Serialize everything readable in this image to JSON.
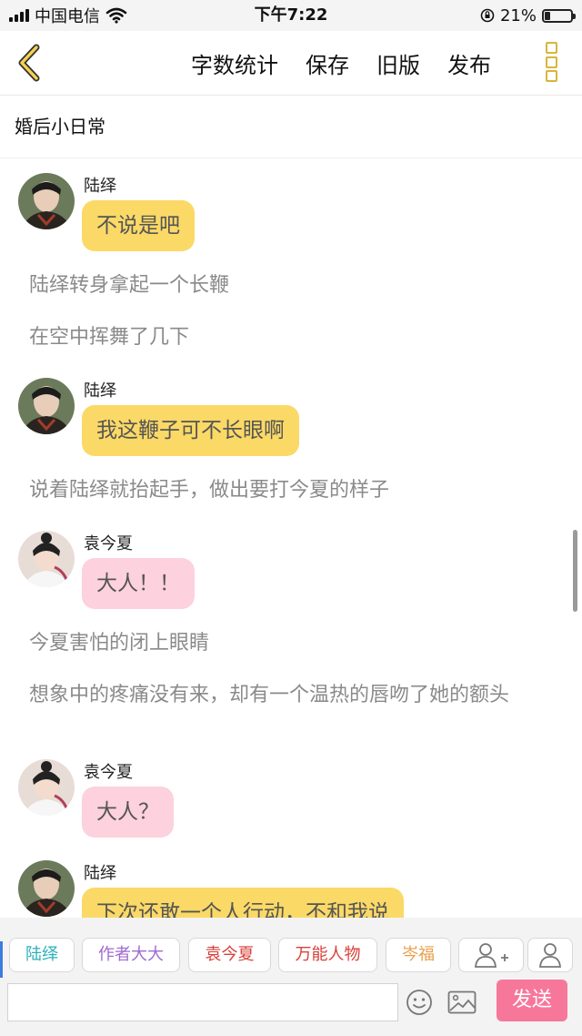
{
  "status_bar": {
    "carrier": "中国电信",
    "time": "下午7:22",
    "battery_text": "21%",
    "battery_level": 0.21
  },
  "header": {
    "menu": [
      "字数统计",
      "保存",
      "旧版",
      "发布"
    ],
    "back_icon": "chevron-left-icon",
    "more_icon": "more-vertical-icon"
  },
  "story": {
    "title": "婚后小日常"
  },
  "messages": [
    {
      "type": "dialog",
      "name": "陆绎",
      "text": "不说是吧",
      "color": "#fbd966"
    },
    {
      "type": "narration",
      "text": "陆绎转身拿起一个长鞭"
    },
    {
      "type": "narration",
      "text": "在空中挥舞了几下"
    },
    {
      "type": "dialog",
      "name": "陆绎",
      "text": "我这鞭子可不长眼啊",
      "color": "#fbd966"
    },
    {
      "type": "narration",
      "text": "说着陆绎就抬起手，做出要打今夏的样子"
    },
    {
      "type": "dialog",
      "name": "袁今夏",
      "text": "大人！！",
      "color": "#fdd1de"
    },
    {
      "type": "narration",
      "text": "今夏害怕的闭上眼睛"
    },
    {
      "type": "narration",
      "text": "想象中的疼痛没有来，却有一个温热的唇吻了她的额头"
    },
    {
      "type": "dialog",
      "name": "袁今夏",
      "text": "大人？",
      "color": "#fdd1de"
    },
    {
      "type": "dialog",
      "name": "陆绎",
      "text": "下次还敢一个人行动，不和我说",
      "color": "#fbd966"
    }
  ],
  "roles": [
    {
      "label": "陆绎",
      "color": "#2fb0b8"
    },
    {
      "label": "作者大大",
      "color": "#a06ad0"
    },
    {
      "label": "袁今夏",
      "color": "#d8403a"
    },
    {
      "label": "万能人物",
      "color": "#d8403a"
    },
    {
      "label": "岑福",
      "color": "#e7a04a"
    }
  ],
  "role_icons": [
    "add-person-icon",
    "person-icon"
  ],
  "input": {
    "placeholder": "",
    "send_label": "发送",
    "emoji_icon": "smile-icon",
    "image_icon": "image-icon"
  }
}
